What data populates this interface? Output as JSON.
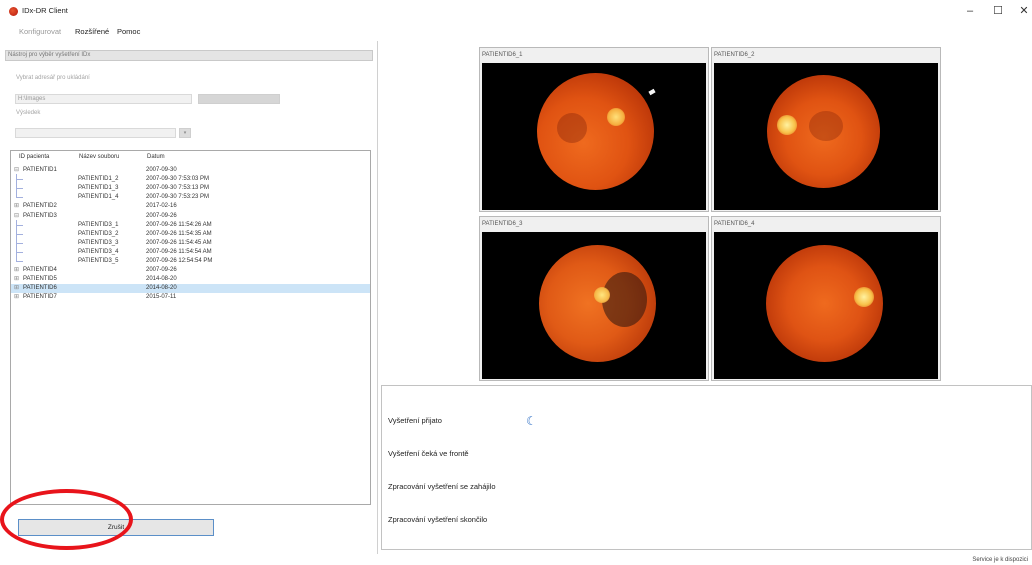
{
  "window": {
    "title": "IDx-DR Client",
    "controls": {
      "minimize": "–",
      "maximize": "☐",
      "close": "✕"
    }
  },
  "menu": [
    "Konfigurovat",
    "Rozšířené",
    "Pomoc"
  ],
  "left_panel": {
    "header": "Nástroj pro výběr vyšetření IDx",
    "storage_label": "Vybrat adresář pro ukládání",
    "storage_path": "H:\\Images",
    "result_label": "Výsledek",
    "result_value": "",
    "tree": {
      "columns": [
        "ID pacienta",
        "Název souboru",
        "Datum"
      ],
      "rows": [
        {
          "id": "PATIENTID1",
          "file": "",
          "date": "2007-09-30",
          "level": 0,
          "expanded": true,
          "selected": false
        },
        {
          "id": "",
          "file": "PATIENTID1_2",
          "date": "2007-09-30 7:53:03 PM",
          "level": 1,
          "expanded": false,
          "selected": false
        },
        {
          "id": "",
          "file": "PATIENTID1_3",
          "date": "2007-09-30 7:53:13 PM",
          "level": 1,
          "expanded": false,
          "selected": false
        },
        {
          "id": "",
          "file": "PATIENTID1_4",
          "date": "2007-09-30 7:53:23 PM",
          "level": 1,
          "expanded": false,
          "selected": false
        },
        {
          "id": "PATIENTID2",
          "file": "",
          "date": "2017-02-16",
          "level": 0,
          "expanded": false,
          "selected": false
        },
        {
          "id": "PATIENTID3",
          "file": "",
          "date": "2007-09-26",
          "level": 0,
          "expanded": true,
          "selected": false
        },
        {
          "id": "",
          "file": "PATIENTID3_1",
          "date": "2007-09-26 11:54:26 AM",
          "level": 1,
          "expanded": false,
          "selected": false
        },
        {
          "id": "",
          "file": "PATIENTID3_2",
          "date": "2007-09-26 11:54:35 AM",
          "level": 1,
          "expanded": false,
          "selected": false
        },
        {
          "id": "",
          "file": "PATIENTID3_3",
          "date": "2007-09-26 11:54:45 AM",
          "level": 1,
          "expanded": false,
          "selected": false
        },
        {
          "id": "",
          "file": "PATIENTID3_4",
          "date": "2007-09-26 11:54:54 AM",
          "level": 1,
          "expanded": false,
          "selected": false
        },
        {
          "id": "",
          "file": "PATIENTID3_5",
          "date": "2007-09-26 12:54:54 PM",
          "level": 1,
          "expanded": false,
          "selected": false
        },
        {
          "id": "PATIENTID4",
          "file": "",
          "date": "2007-09-26",
          "level": 0,
          "expanded": false,
          "selected": false
        },
        {
          "id": "PATIENTID5",
          "file": "",
          "date": "2014-08-20",
          "level": 0,
          "expanded": false,
          "selected": false
        },
        {
          "id": "PATIENTID6",
          "file": "",
          "date": "2014-08-20",
          "level": 0,
          "expanded": false,
          "selected": true
        },
        {
          "id": "PATIENTID7",
          "file": "",
          "date": "2015-07-11",
          "level": 0,
          "expanded": false,
          "selected": false
        }
      ]
    },
    "cancel_button": "Zrušit"
  },
  "images": [
    {
      "label": "PATIENTID6_1"
    },
    {
      "label": "PATIENTID6_2"
    },
    {
      "label": "PATIENTID6_3"
    },
    {
      "label": "PATIENTID6_4"
    }
  ],
  "status": {
    "lines": [
      "Vyšetření přijato",
      "Vyšetření čeká ve frontě",
      "Zpracování vyšetření se zahájilo",
      "Zpracování vyšetření skončilo"
    ],
    "spinner_icon": "loading-spinner-icon"
  },
  "statusbar": {
    "text": "Service je k dispozici"
  },
  "colors": {
    "selection": "#cce4f7",
    "highlight_circle": "#e8141b",
    "button_border": "#5b8fc8"
  }
}
